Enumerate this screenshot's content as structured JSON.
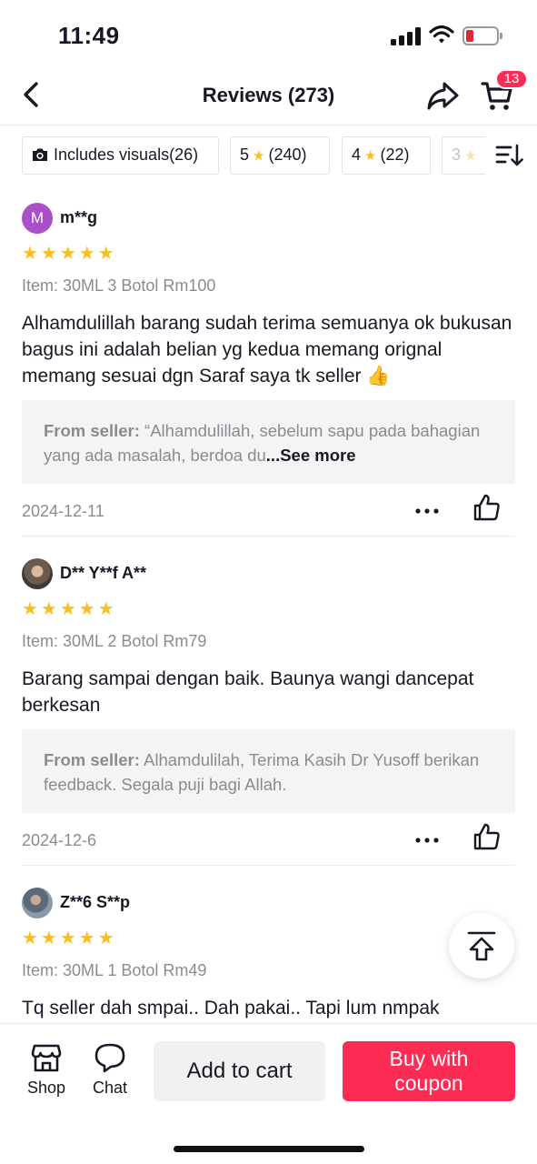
{
  "status_bar": {
    "time": "11:49"
  },
  "header": {
    "title": "Reviews (273)",
    "cart_badge": "13"
  },
  "filters": [
    {
      "label": "Includes visuals",
      "count": "(26)",
      "icon": "camera-icon"
    },
    {
      "label": "5",
      "count": "(240)",
      "icon": "star-icon"
    },
    {
      "label": "4",
      "count": "(22)",
      "icon": "star-icon"
    },
    {
      "label": "3",
      "count": "",
      "icon": "star-icon"
    }
  ],
  "reviews": [
    {
      "avatar_letter": "M",
      "name": "m**g",
      "rating": 5,
      "stars": "★★★★★",
      "item": "Item: 30ML 3 Botol Rm100",
      "text": "Alhamdulillah barang sudah terima semuanya ok bukusan bagus ini adalah belian yg kedua memang orignal memang sesuai dgn Saraf saya tk seller 👍",
      "seller_label": "From seller:",
      "seller_reply": "“Alhamdulillah, sebelum sapu pada bahagian yang ada masalah, berdoa du",
      "see_more": "...See more",
      "date": "2024-12-11"
    },
    {
      "avatar_letter": "",
      "name": "D** Y**f A**",
      "rating": 5,
      "stars": "★★★★★",
      "item": "Item: 30ML 2 Botol Rm79",
      "text": "Barang sampai dengan baik. Baunya wangi dancepat berkesan",
      "seller_label": "From seller:",
      "seller_reply": "Alhamdulilah, Terima Kasih Dr Yusoff berikan feedback. Segala puji bagi Allah.",
      "see_more": "",
      "date": "2024-12-6"
    },
    {
      "avatar_letter": "",
      "name": "Z**6 S**p",
      "rating": 5,
      "stars": "★★★★★",
      "item": "Item: 30ML 1 Botol Rm49",
      "text": "Tq seller dah smpai.. Dah pakai.. Tapi lum nmpak",
      "date": ""
    }
  ],
  "bottom_bar": {
    "shop_label": "Shop",
    "chat_label": "Chat",
    "add_to_cart": "Add to cart",
    "buy_line1": "Buy with",
    "buy_line2": "coupon"
  },
  "colors": {
    "accent": "#fe2c55",
    "star": "#fabe1e",
    "muted": "#8a8b91"
  }
}
